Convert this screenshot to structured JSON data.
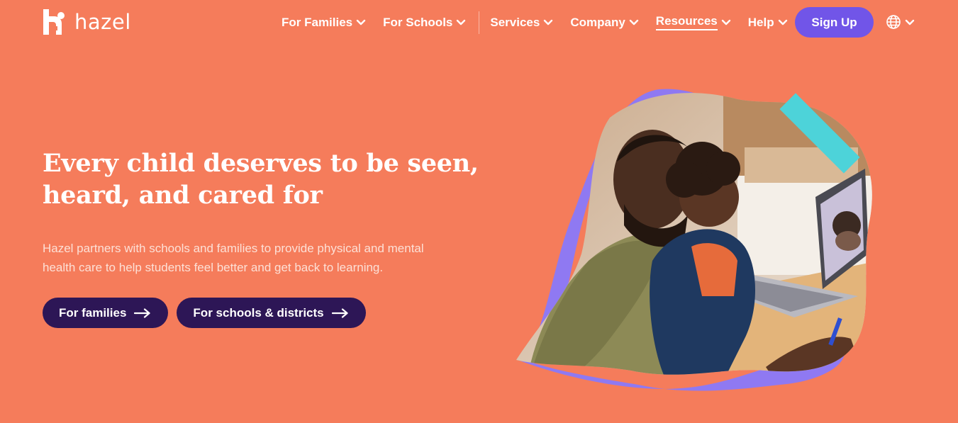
{
  "brand": {
    "name": "hazel",
    "logo_icon": "hazel-logo-icon",
    "colors": {
      "background": "#f57c5b",
      "accent": "#7155e8",
      "button_dark": "#2d1656",
      "teal": "#4dd3d9",
      "purple_blob": "#8f79f2"
    }
  },
  "nav": {
    "items": [
      {
        "label": "For Families",
        "icon": "chevron-down-icon"
      },
      {
        "label": "For Schools",
        "icon": "chevron-down-icon"
      },
      {
        "label": "Services",
        "icon": "chevron-down-icon"
      },
      {
        "label": "Company",
        "icon": "chevron-down-icon"
      },
      {
        "label": "Resources",
        "icon": "chevron-down-icon",
        "active": true
      },
      {
        "label": "Help",
        "icon": "chevron-down-icon"
      }
    ],
    "signup_label": "Sign Up",
    "language_icon": "globe-icon"
  },
  "hero": {
    "headline_line1": "Every child deserves to be seen,",
    "headline_line2": "heard, and cared for",
    "subcopy_line1": "Hazel partners with schools and families to provide physical and mental",
    "subcopy_line2": "health care to help students feel better and get back to learning.",
    "cta_families": "For families",
    "cta_schools": "For schools & districts",
    "cta_icon": "arrow-right-icon",
    "image_icon": "telehealth-photo-illustration"
  }
}
